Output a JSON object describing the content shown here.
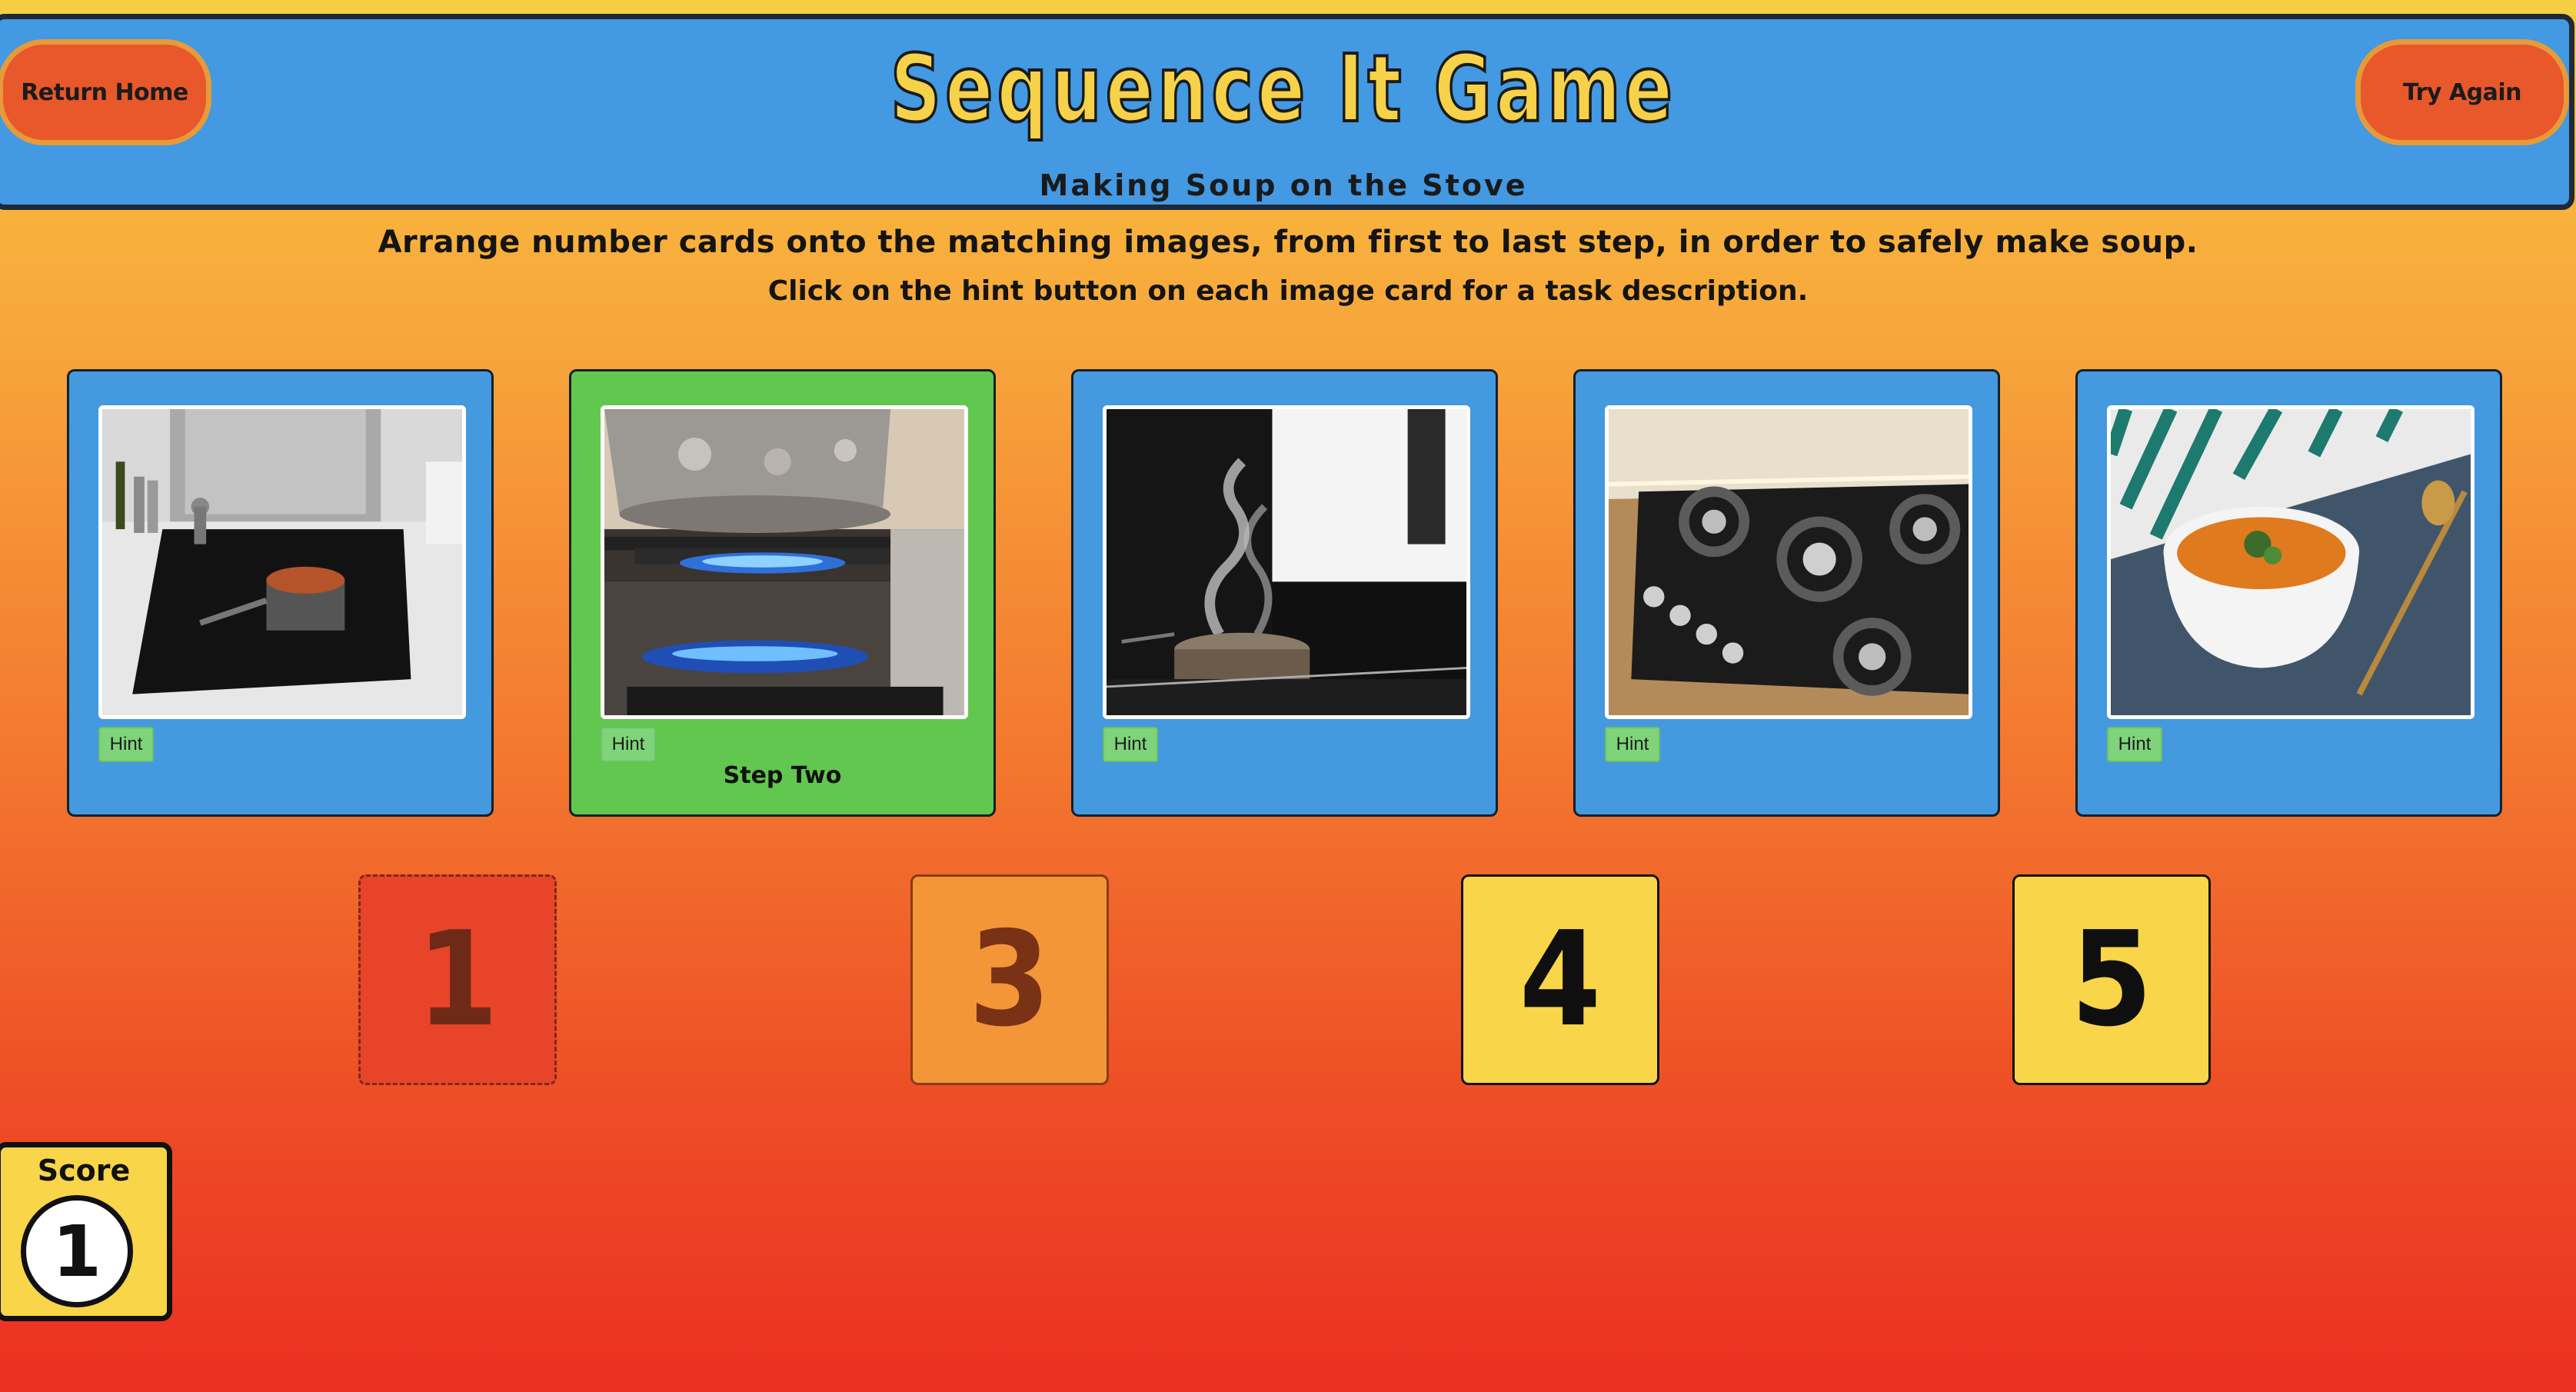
{
  "header": {
    "return_home": "Return Home",
    "try_again": "Try Again",
    "title": "Sequence It Game",
    "subtitle": "Making Soup on the Stove"
  },
  "instructions": {
    "line1": "Arrange number cards onto the matching images, from first to last step, in order to safely make soup.",
    "line2": "Click on the hint button on each image card for a task description."
  },
  "image_cards": [
    {
      "image": "pot-on-induction-cooktop",
      "hint": "Hint",
      "step_label": "",
      "state": "unplaced"
    },
    {
      "image": "pot-on-gas-flame",
      "hint": "Hint",
      "step_label": "Step Two",
      "state": "correct"
    },
    {
      "image": "steaming-pot",
      "hint": "Hint",
      "step_label": "",
      "state": "unplaced"
    },
    {
      "image": "gas-stovetop-off",
      "hint": "Hint",
      "step_label": "",
      "state": "unplaced"
    },
    {
      "image": "bowl-of-soup",
      "hint": "Hint",
      "step_label": "",
      "state": "unplaced"
    }
  ],
  "number_cards": [
    {
      "label": "1",
      "state": "placeholder"
    },
    {
      "label": "3",
      "state": "disabled"
    },
    {
      "label": "4",
      "state": "available"
    },
    {
      "label": "5",
      "state": "available"
    }
  ],
  "score": {
    "label": "Score",
    "value": "1"
  },
  "colors": {
    "header_blue": "#4399e2",
    "card_blue": "#4499df",
    "correct_green": "#62c74e",
    "title_yellow": "#f6d24a",
    "button_orange": "#e8582a",
    "hint_green": "#7fd37a",
    "number_yellow": "#f9d54a"
  }
}
